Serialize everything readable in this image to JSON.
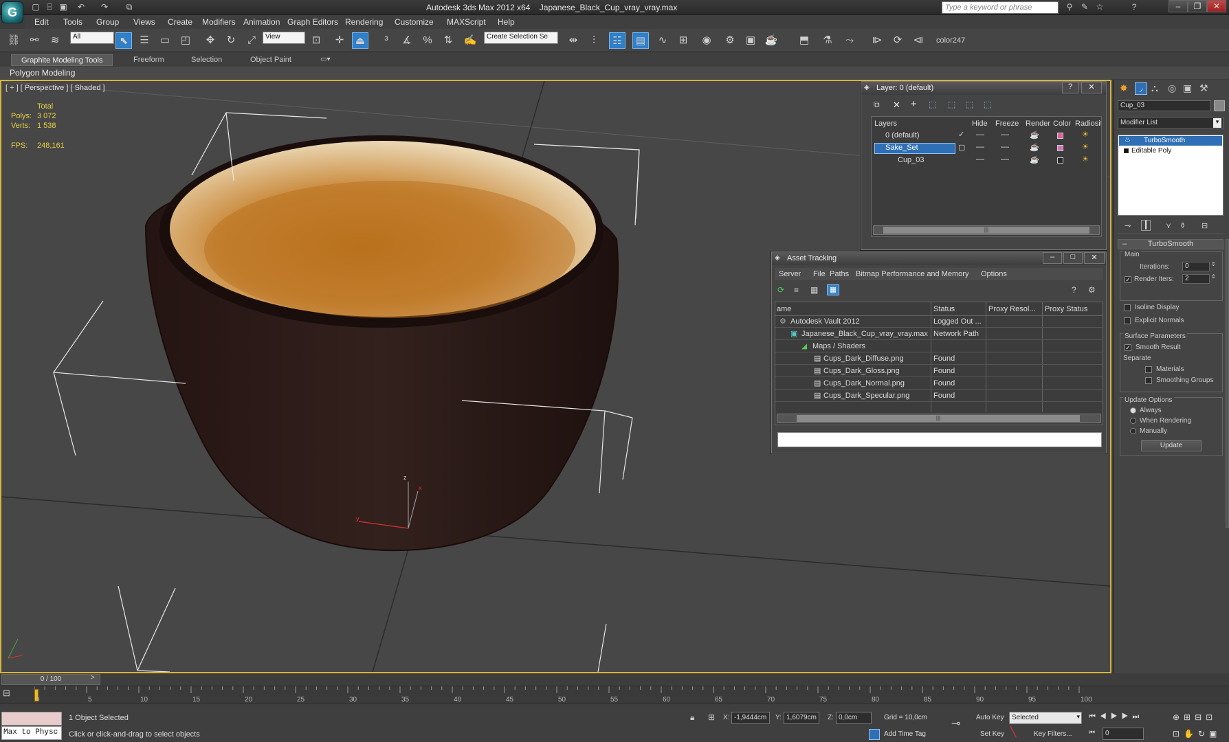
{
  "app": {
    "title": "Autodesk 3ds Max  2012 x64",
    "filename": "Japanese_Black_Cup_vray_vray.max",
    "search_placeholder": "Type a keyword or phrase"
  },
  "menu": [
    "Edit",
    "Tools",
    "Group",
    "Views",
    "Create",
    "Modifiers",
    "Animation",
    "Graph Editors",
    "Rendering",
    "Customize",
    "MAXScript",
    "Help"
  ],
  "toolbar": {
    "selection_filter": "All",
    "ref_coord": "View",
    "named_selection": "Create Selection Se",
    "color_label": "color247"
  },
  "ribbon": {
    "tabs": [
      "Graphite Modeling Tools",
      "Freeform",
      "Selection",
      "Object Paint"
    ],
    "sub_label": "Polygon Modeling"
  },
  "viewport": {
    "label": "[ + ] [ Perspective ] [ Shaded ]",
    "stats": {
      "total_label": "Total",
      "polys_label": "Polys:",
      "polys": "3 072",
      "verts_label": "Verts:",
      "verts": "1 538",
      "fps_label": "FPS:",
      "fps": "248,161"
    },
    "gizmo": {
      "x": "x",
      "y": "y",
      "z": "z"
    }
  },
  "layer_window": {
    "title": "Layer: 0 (default)",
    "columns": [
      "Layers",
      "Hide",
      "Freeze",
      "Render",
      "Color",
      "Radiosit"
    ],
    "rows": [
      {
        "name": "0 (default)",
        "color": "#e0609a"
      },
      {
        "name": "Sake_Set",
        "color": "#d470b8"
      },
      {
        "name": "Cup_03",
        "color": "#2a2a2a"
      }
    ]
  },
  "asset_window": {
    "title": "Asset Tracking",
    "menu": [
      "Server",
      "File",
      "Paths",
      "Bitmap Performance and Memory",
      "Options"
    ],
    "columns": [
      "ame",
      "Status",
      "Proxy Resol...",
      "Proxy Status"
    ],
    "rows": [
      {
        "name": "Autodesk Vault 2012",
        "status": "Logged Out ..."
      },
      {
        "name": "Japanese_Black_Cup_vray_vray.max",
        "status": "Network Path"
      },
      {
        "name": "Maps / Shaders",
        "status": ""
      },
      {
        "name": "Cups_Dark_Diffuse.png",
        "status": "Found"
      },
      {
        "name": "Cups_Dark_Gloss.png",
        "status": "Found"
      },
      {
        "name": "Cups_Dark_Normal.png",
        "status": "Found"
      },
      {
        "name": "Cups_Dark_Specular.png",
        "status": "Found"
      }
    ]
  },
  "command_panel": {
    "object_name": "Cup_03",
    "modifier_list_label": "Modifier List",
    "stack": [
      "TurboSmooth",
      "Editable Poly"
    ],
    "rollout_title": "TurboSmooth",
    "main_label": "Main",
    "iterations_label": "Iterations:",
    "iterations": "0",
    "render_iters_label": "Render Iters:",
    "render_iters": "2",
    "isoline_label": "Isoline Display",
    "explicit_normals_label": "Explicit Normals",
    "surface_params_label": "Surface Parameters",
    "smooth_result_label": "Smooth Result",
    "separate_label": "Separate",
    "materials_label": "Materials",
    "smoothing_groups_label": "Smoothing Groups",
    "update_options_label": "Update Options",
    "always_label": "Always",
    "when_rendering_label": "When Rendering",
    "manually_label": "Manually",
    "update_button": "Update"
  },
  "timeline": {
    "frame_label": "0 / 100",
    "ticks": [
      "0",
      "5",
      "10",
      "15",
      "20",
      "25",
      "30",
      "35",
      "40",
      "45",
      "50",
      "55",
      "60",
      "65",
      "70",
      "75",
      "80",
      "85",
      "90",
      "95",
      "100"
    ]
  },
  "status": {
    "maxscript_label": "Max to Physc",
    "selection_text": "1 Object Selected",
    "prompt_text": "Click or click-and-drag to select objects",
    "x_label": "X:",
    "x": "-1,9444cm",
    "y_label": "Y:",
    "y": "1,6079cm",
    "z_label": "Z:",
    "z": "0,0cm",
    "grid": "Grid = 10,0cm",
    "auto_key": "Auto Key",
    "set_key": "Set Key",
    "selected_dropdown": "Selected",
    "key_filters": "Key Filters...",
    "add_time_tag": "Add Time Tag",
    "frame_field": "0"
  }
}
